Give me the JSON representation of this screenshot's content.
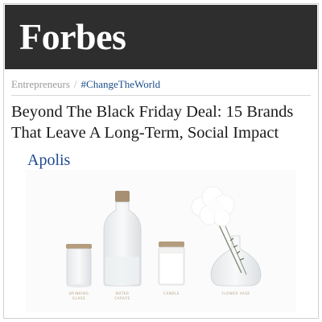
{
  "masthead": {
    "logo": "Forbes"
  },
  "breadcrumb": {
    "section": "Entrepreneurs",
    "separator": "/",
    "tag": "#ChangeTheWorld"
  },
  "article": {
    "title_line1": "Beyond The Black Friday Deal: 15 Brands",
    "title_line2": "That Leave A Long-Term, Social Impact",
    "brand": "Apolis"
  },
  "photo": {
    "labels": {
      "drinking_glass": "DRINKING GLASS",
      "water_carafe": "WATER CARAFE",
      "candle": "CANDLE",
      "flower_vase": "FLOWER VASE"
    }
  },
  "colors": {
    "masthead_bg": "#2e2e2e",
    "tag_link": "#1b4d8c",
    "brand_link": "#1f4a93"
  }
}
